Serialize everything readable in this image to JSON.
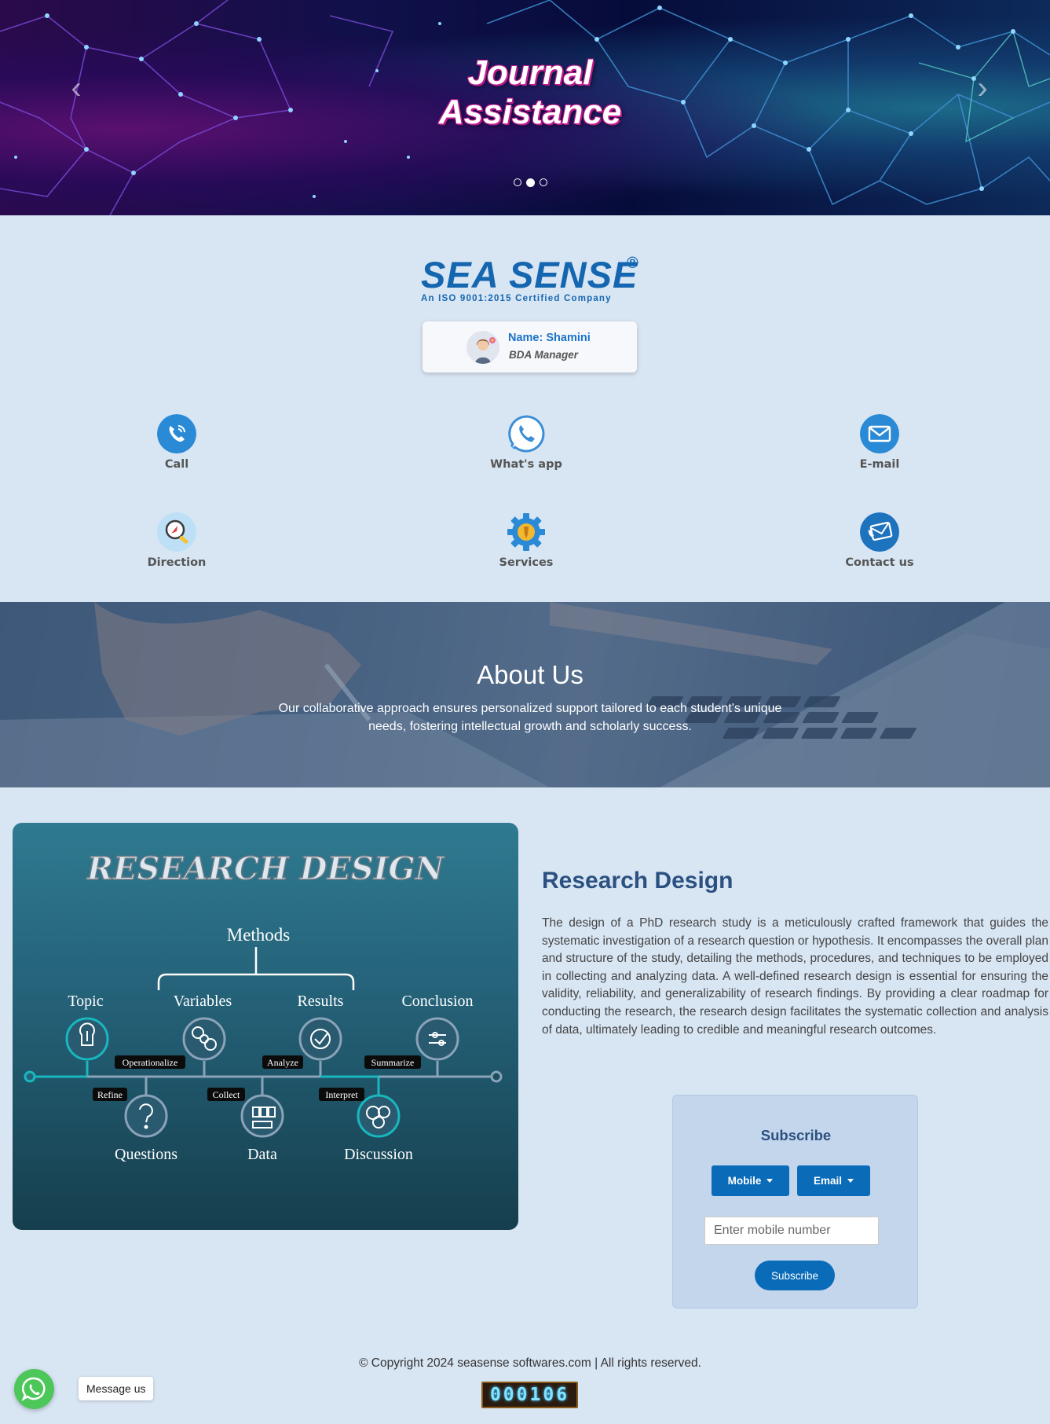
{
  "hero": {
    "title_line1": "Journal",
    "title_line2": "Assistance",
    "prev_icon": "chevron-left-icon",
    "next_icon": "chevron-right-icon",
    "active_slide": 2,
    "slide_count": 3
  },
  "logo": {
    "name": "SEA SENSE",
    "registered": "®",
    "tagline": "An ISO 9001:2015 Certified Company"
  },
  "contact_card": {
    "name": "Name: Shamini",
    "role": "BDA Manager"
  },
  "quick_links": [
    {
      "label": "Call",
      "icon": "phone-icon"
    },
    {
      "label": "What's app",
      "icon": "whatsapp-icon"
    },
    {
      "label": "E-mail",
      "icon": "mail-icon"
    },
    {
      "label": "Direction",
      "icon": "map-pin-icon"
    },
    {
      "label": "Services",
      "icon": "gear-icon"
    },
    {
      "label": "Contact us",
      "icon": "contact-icon"
    }
  ],
  "about": {
    "title": "About Us",
    "text": "Our collaborative approach ensures personalized support tailored to each student's unique needs, fostering intellectual growth and scholarly success."
  },
  "research_image": {
    "heading": "RESEARCH DESIGN",
    "methods": "Methods",
    "top_labels": [
      "Topic",
      "Variables",
      "Results",
      "Conclusion"
    ],
    "bottom_labels": [
      "Questions",
      "Data",
      "Discussion"
    ],
    "tags": [
      "Operationalize",
      "Analyze",
      "Summarize",
      "Refine",
      "Collect",
      "Interpret"
    ]
  },
  "research": {
    "title": "Research Design",
    "body": "The design of a PhD research study is a meticulously crafted framework that guides the systematic investigation of a research question or hypothesis. It encompasses the overall plan and structure of the study, detailing the methods, procedures, and techniques to be employed in collecting and analyzing data. A well-defined research design is essential for ensuring the validity, reliability, and generalizability of research findings. By providing a clear roadmap for conducting the research, the research design facilitates the systematic collection and analysis of data, ultimately leading to credible and meaningful research outcomes."
  },
  "subscribe": {
    "title": "Subscribe",
    "mobile_label": "Mobile",
    "email_label": "Email",
    "placeholder": "Enter mobile number",
    "submit_label": "Subscribe"
  },
  "footer": {
    "copyright": "© Copyright 2024 seasense softwares.com | All rights reserved.",
    "counter": "000106",
    "message_label": "Message us"
  },
  "colors": {
    "brand_blue": "#1566b0",
    "button_blue": "#0a6bb8",
    "page_bg": "#d8e5f3",
    "whatsapp_green": "#4ec75a"
  }
}
